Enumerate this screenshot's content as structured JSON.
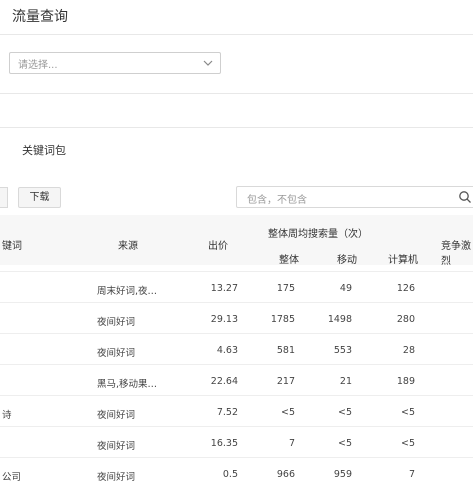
{
  "header": {
    "title": "流量查询"
  },
  "filter": {
    "select_placeholder": "请选择..."
  },
  "section": {
    "title": "关键词包"
  },
  "toolbar": {
    "download_label": "下载",
    "search_placeholder": "包含，不包含"
  },
  "table": {
    "headers": {
      "keyword": "键词",
      "source": "来源",
      "bid": "出价",
      "group": "整体周均搜索量（次）",
      "overall": "整体",
      "mobile": "移动",
      "pc": "计算机",
      "competition": "竞争激烈"
    },
    "rows": [
      {
        "keyword": "",
        "source": "周末好词,夜…",
        "bid": "13.27",
        "overall": "175",
        "mobile": "49",
        "pc": "126"
      },
      {
        "keyword": "",
        "source": "夜间好词",
        "bid": "29.13",
        "overall": "1785",
        "mobile": "1498",
        "pc": "280"
      },
      {
        "keyword": "",
        "source": "夜间好词",
        "bid": "4.63",
        "overall": "581",
        "mobile": "553",
        "pc": "28"
      },
      {
        "keyword": "",
        "source": "黑马,移动果…",
        "bid": "22.64",
        "overall": "217",
        "mobile": "21",
        "pc": "189"
      },
      {
        "keyword": "诗",
        "source": "夜间好词",
        "bid": "7.52",
        "overall": "<5",
        "mobile": "<5",
        "pc": "<5"
      },
      {
        "keyword": "",
        "source": "夜间好词",
        "bid": "16.35",
        "overall": "7",
        "mobile": "<5",
        "pc": "<5"
      },
      {
        "keyword": "公司",
        "source": "夜间好词",
        "bid": "0.5",
        "overall": "966",
        "mobile": "959",
        "pc": "7"
      }
    ]
  }
}
